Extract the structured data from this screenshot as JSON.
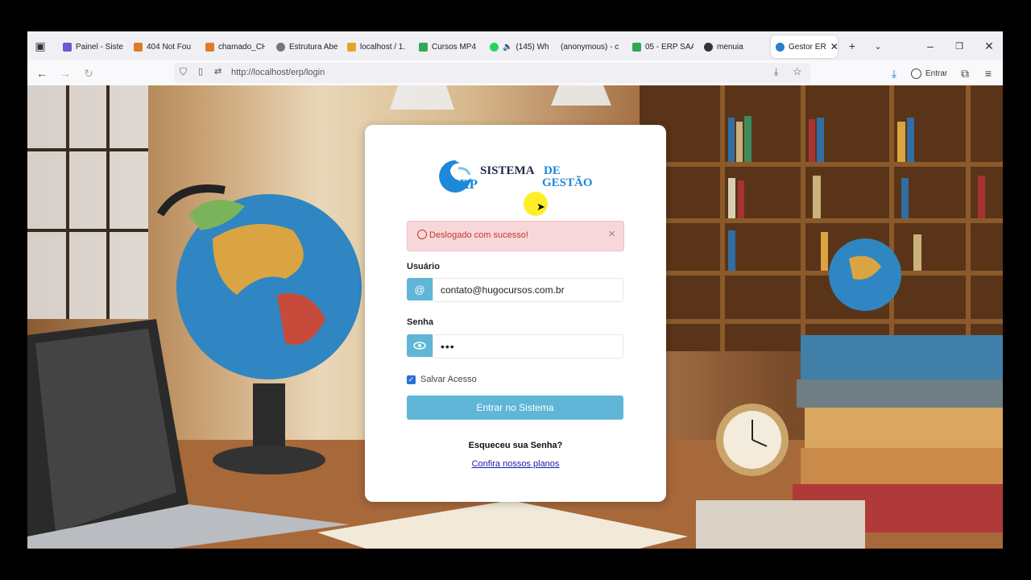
{
  "tabs": [
    {
      "label": "Painel - Siste",
      "icon": "painel-favicon",
      "color": "#6a5acd"
    },
    {
      "label": "404 Not Fou",
      "icon": "404-favicon",
      "color": "#e07a2b"
    },
    {
      "label": "chamado_CH",
      "icon": "chamado-favicon",
      "color": "#e07a2b"
    },
    {
      "label": "Estrutura Abe",
      "icon": "globe-favicon",
      "color": "#777777"
    },
    {
      "label": "localhost / 1.",
      "icon": "phpmyadmin-favicon",
      "color": "#e8a22b"
    },
    {
      "label": "Cursos MP4",
      "icon": "drive-favicon",
      "color": "#34a853"
    },
    {
      "label": "(145) Wh",
      "icon": "whatsapp-favicon",
      "color": "#25d366"
    },
    {
      "label": "(anonymous) - c",
      "icon": "blank-favicon",
      "color": "#dddddd"
    },
    {
      "label": "05 - ERP SAA",
      "icon": "drive-favicon",
      "color": "#34a853"
    },
    {
      "label": "menuia",
      "icon": "menuia-favicon",
      "color": "#333333"
    },
    {
      "label": "Gestor ER",
      "icon": "gestor-favicon",
      "color": "#2a7fc9"
    }
  ],
  "toolbar": {
    "url": "http://localhost/erp/login",
    "signin_label": "Entrar"
  },
  "logo": {
    "erp": "ERP",
    "sistema": "SISTEMA",
    "de": "DE",
    "gestao": "GESTÃO"
  },
  "login": {
    "alert_text": "Deslogado com sucesso!",
    "alert_close": "×",
    "user_label": "Usuário",
    "user_icon": "@",
    "user_value": "contato@hugocursos.com.br",
    "password_label": "Senha",
    "password_value": "•••",
    "remember_label": "Salvar Acesso",
    "remember_checked": true,
    "submit_label": "Entrar no Sistema",
    "forgot_text": "Esqueceu sua Senha?",
    "plans_link": "Confira nossos planos"
  },
  "colors": {
    "accent": "#5fb6d6",
    "alert_bg": "#f8d7da",
    "alert_text": "#c0392b",
    "link": "#1a1aa6",
    "logo_blue": "#1e88d9",
    "logo_dark": "#1b2a44"
  }
}
